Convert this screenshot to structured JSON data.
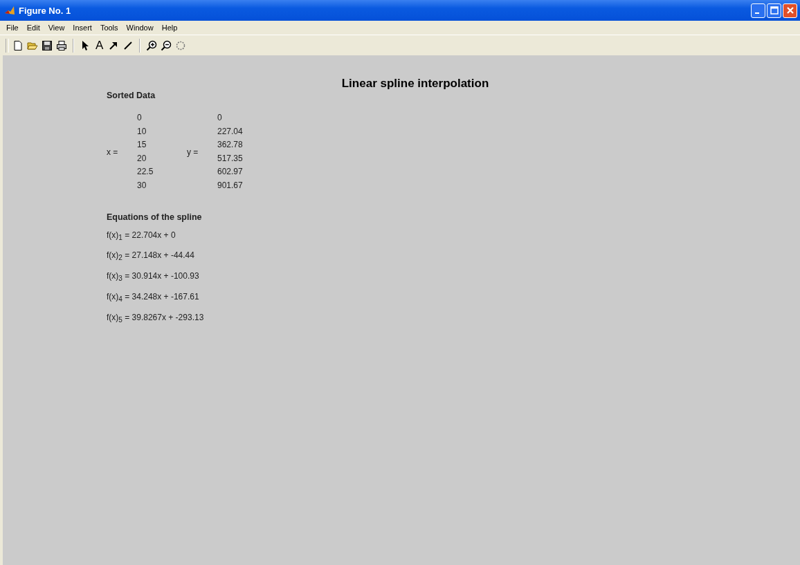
{
  "window": {
    "title": "Figure No. 1"
  },
  "menu": [
    "File",
    "Edit",
    "View",
    "Insert",
    "Tools",
    "Window",
    "Help"
  ],
  "toolbar": [
    {
      "kind": "new"
    },
    {
      "kind": "open"
    },
    {
      "kind": "save"
    },
    {
      "kind": "print"
    },
    {
      "kind": "sep"
    },
    {
      "kind": "pointer"
    },
    {
      "kind": "text",
      "label": "A"
    },
    {
      "kind": "arrow"
    },
    {
      "kind": "line"
    },
    {
      "kind": "sep"
    },
    {
      "kind": "zoomin"
    },
    {
      "kind": "zoomout"
    },
    {
      "kind": "rotate"
    }
  ],
  "figure": {
    "title": "Linear spline interpolation",
    "sorted_heading": "Sorted Data",
    "x_label": "x =",
    "x_values": [
      "0",
      "10",
      "15",
      "20",
      "22.5",
      "30"
    ],
    "y_label": "y =",
    "y_values": [
      "0",
      "227.04",
      "362.78",
      "517.35",
      "602.97",
      "901.67"
    ],
    "equations_heading": "Equations of the spline",
    "equations": [
      "f(x)$_{1}$ = 22.704x + 0",
      "f(x)$_{2}$ = 27.148x + -44.44",
      "f(x)$_{3}$ = 30.914x + -100.93",
      "f(x)$_{4}$ = 34.248x + -167.61",
      "f(x)$_{5}$ = 39.8267x + -293.13"
    ]
  }
}
